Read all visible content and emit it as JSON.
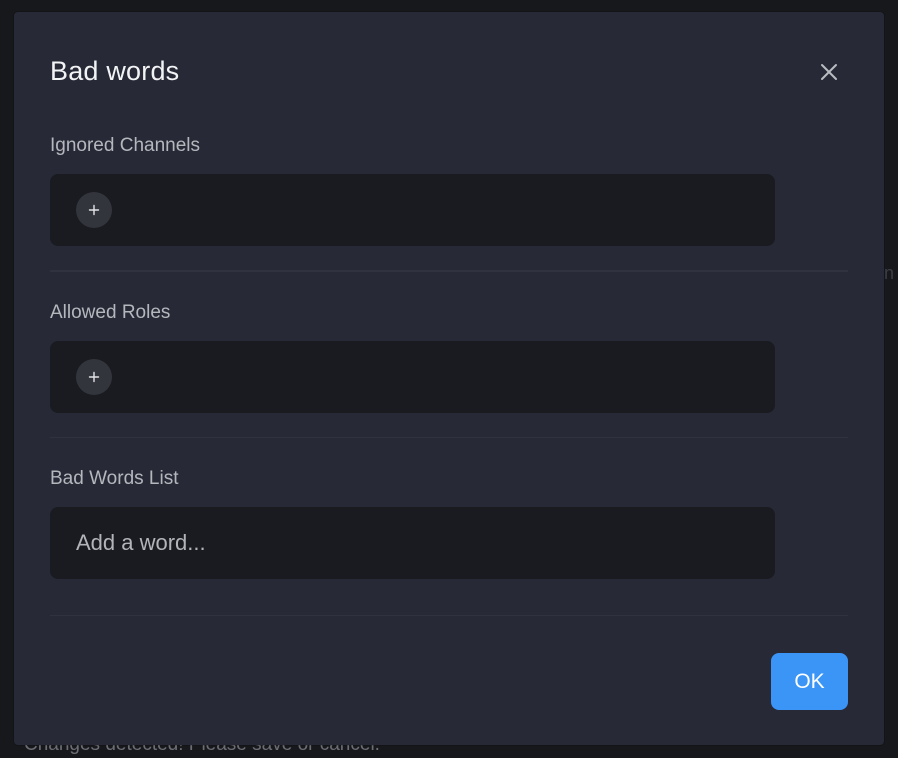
{
  "background": {
    "notice": "Changes detected! Please save or cancel.",
    "edge_glyph": "n"
  },
  "modal": {
    "title": "Bad words",
    "close_icon": "close-icon"
  },
  "sections": {
    "ignored_channels": {
      "label": "Ignored Channels",
      "add_icon": "plus-icon"
    },
    "allowed_roles": {
      "label": "Allowed Roles",
      "add_icon": "plus-icon"
    },
    "bad_words_list": {
      "label": "Bad Words List",
      "input_placeholder": "Add a word...",
      "input_value": ""
    }
  },
  "footer": {
    "ok_label": "OK"
  },
  "colors": {
    "modal_bg": "#272a36",
    "field_bg": "#1a1b20",
    "accent": "#3b95f7",
    "title_text": "#f2f3f5",
    "label_text": "#b5b7bd"
  }
}
